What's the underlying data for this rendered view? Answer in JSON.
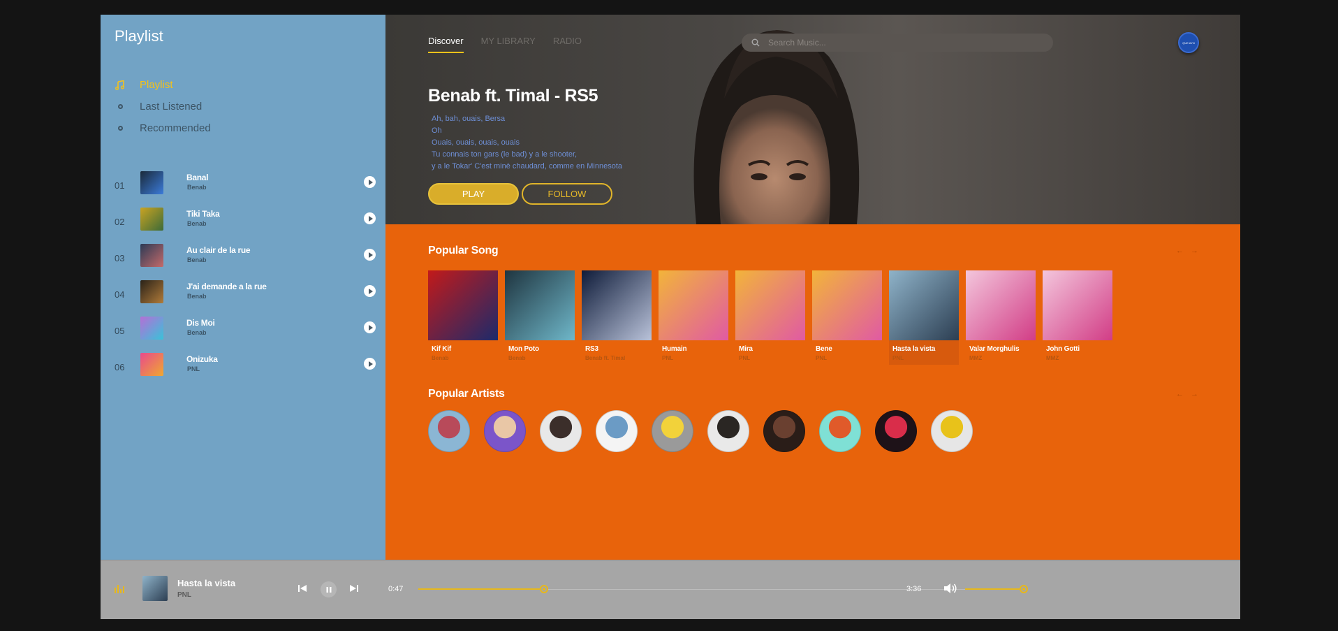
{
  "sidebar": {
    "title": "Playlist",
    "nav": [
      {
        "label": "Playlist",
        "active": true
      },
      {
        "label": "Last Listened",
        "active": false
      },
      {
        "label": "Recommended",
        "active": false
      }
    ],
    "tracks": [
      {
        "num": "01",
        "name": "Banal",
        "artist": "Benab",
        "cover": [
          "#1a2a3a",
          "#3b7bd9"
        ]
      },
      {
        "num": "02",
        "name": "Tiki Taka",
        "artist": "Benab",
        "cover": [
          "#c9a322",
          "#3d6b38"
        ]
      },
      {
        "num": "03",
        "name": "Au clair de la rue",
        "artist": "Benab",
        "cover": [
          "#2b3a55",
          "#c46a6a"
        ]
      },
      {
        "num": "04",
        "name": "J'ai demande a la rue",
        "artist": "Benab",
        "cover": [
          "#2a2218",
          "#b07b3a"
        ]
      },
      {
        "num": "05",
        "name": "Dis Moi",
        "artist": "Benab",
        "cover": [
          "#b56fd6",
          "#39c2d9"
        ]
      },
      {
        "num": "06",
        "name": "Onizuka",
        "artist": "PNL",
        "cover": [
          "#e84a8c",
          "#f0a830"
        ]
      }
    ]
  },
  "header": {
    "tabs": [
      {
        "label": "Discover",
        "active": true
      },
      {
        "label": "MY LIBRARY",
        "active": false
      },
      {
        "label": "RADIO",
        "active": false
      }
    ],
    "search_placeholder": "Search Music...",
    "avatar_text": "QUE AYN"
  },
  "hero": {
    "title": "Benab ft. Timal - RS5",
    "lyrics": [
      "Ah, bah, ouais, Bersa",
      "Oh",
      "Ouais, ouais, ouais, ouais",
      "Tu connais ton gars (le bad) y a le shooter,",
      "y a le Tokar' C'est minè chaudard, comme en Minnesota"
    ],
    "play_label": "PLAY",
    "follow_label": "FOLLOW"
  },
  "popular_songs": {
    "title": "Popular Song",
    "items": [
      {
        "name": "Kif Kif",
        "artist": "Benab",
        "cover": [
          "#c21a1a",
          "#1c2a6b"
        ],
        "highlight": false
      },
      {
        "name": "Mon Poto",
        "artist": "Benab",
        "cover": [
          "#1f3540",
          "#6fb7c9"
        ],
        "highlight": false
      },
      {
        "name": "RS3",
        "artist": "Benab ft. Timal",
        "cover": [
          "#0f1c3a",
          "#b9c2d9"
        ],
        "highlight": false
      },
      {
        "name": "Humain",
        "artist": "PNL",
        "cover": [
          "#f2b43a",
          "#e05aa3"
        ],
        "highlight": false
      },
      {
        "name": "Mira",
        "artist": "PNL",
        "cover": [
          "#f2b43a",
          "#e05aa3"
        ],
        "highlight": false
      },
      {
        "name": "Bene",
        "artist": "PNL",
        "cover": [
          "#f2b43a",
          "#e05aa3"
        ],
        "highlight": false
      },
      {
        "name": "Hasta la vista",
        "artist": "PNL",
        "cover": [
          "#8fb3c9",
          "#2c3e52"
        ],
        "highlight": true
      },
      {
        "name": "Valar Morghulis",
        "artist": "MMZ",
        "cover": [
          "#f3c6dc",
          "#d23d86"
        ],
        "highlight": false
      },
      {
        "name": "John Gotti",
        "artist": "MMZ",
        "cover": [
          "#f3c6dc",
          "#d23d86"
        ],
        "highlight": false
      }
    ]
  },
  "popular_artists": {
    "title": "Popular Artists",
    "items": [
      {
        "name": "artist-1",
        "color": [
          "#8bb6d4",
          "#b84a5a"
        ]
      },
      {
        "name": "artist-2",
        "color": [
          "#7b55c9",
          "#e9c7a6"
        ]
      },
      {
        "name": "artist-3",
        "color": [
          "#e8e8e8",
          "#3b2e2a"
        ]
      },
      {
        "name": "artist-4",
        "color": [
          "#f4f4f4",
          "#6b9bc5"
        ]
      },
      {
        "name": "artist-5",
        "color": [
          "#9a9a9a",
          "#f2d23a"
        ]
      },
      {
        "name": "artist-6",
        "color": [
          "#e9e9e9",
          "#2a2623"
        ]
      },
      {
        "name": "artist-7",
        "color": [
          "#2a1d18",
          "#6a4030"
        ]
      },
      {
        "name": "artist-8",
        "color": [
          "#7fe0d5",
          "#e05a2a"
        ]
      },
      {
        "name": "artist-9",
        "color": [
          "#1e1218",
          "#d92d4a"
        ]
      },
      {
        "name": "artist-10",
        "color": [
          "#e6e6e6",
          "#e8c21a"
        ]
      }
    ]
  },
  "player": {
    "title": "Hasta la vista",
    "artist": "PNL",
    "current_time": "0:47",
    "total_time": "3:36",
    "progress": 0.217,
    "volume": 0.84
  },
  "colors": {
    "accent": "#f3c21a",
    "sidebar": "#72a3c5",
    "main": "#e8630b",
    "player": "#a6a6a6"
  }
}
